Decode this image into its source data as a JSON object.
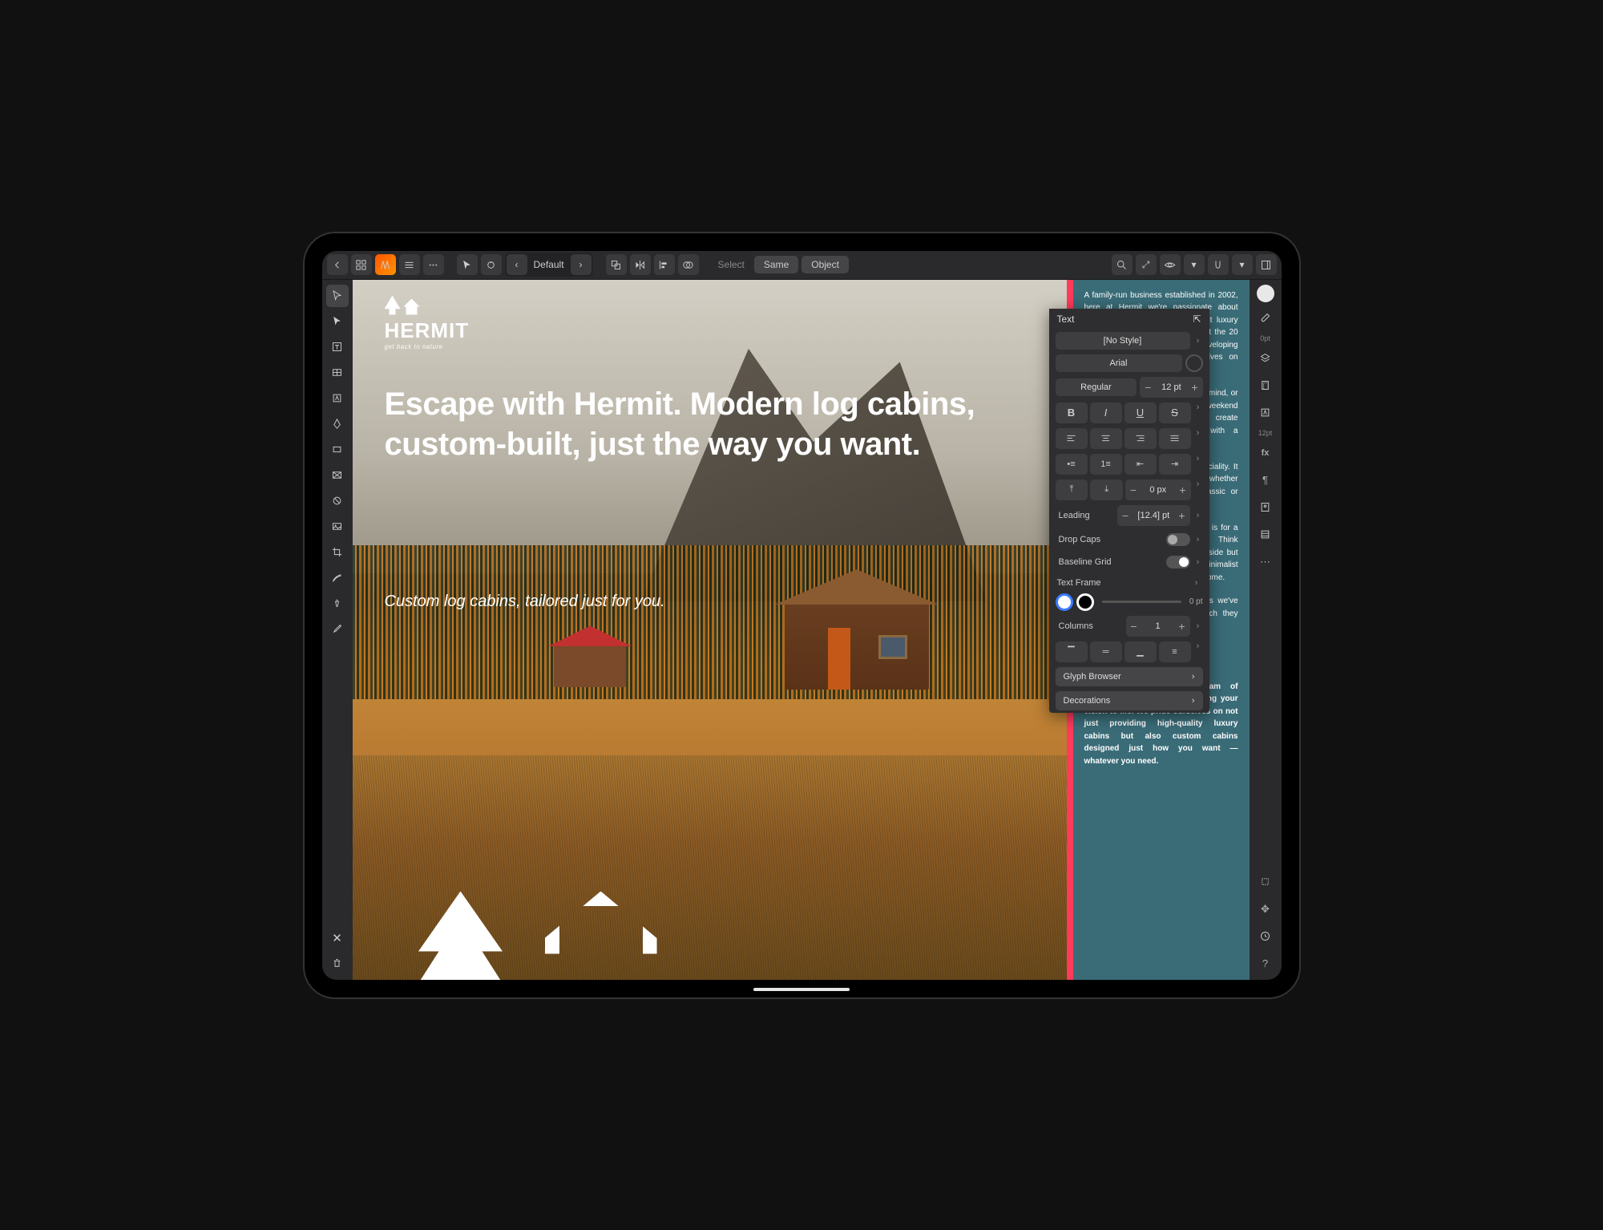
{
  "topbar": {
    "preset_label": "Default",
    "select_label": "Select",
    "same_label": "Same",
    "object_label": "Object"
  },
  "document": {
    "brand_name": "HERMIT",
    "brand_tagline": "get back to nature",
    "headline": "Escape with Hermit. Modern log cabins, custom-built, just the way you want.",
    "subhead": "Custom log cabins, tailored just for you.",
    "body": {
      "p1": "A family-run business established in 2002, here at Hermit we're passionate about bringing your vision of the perfect luxury log cabin to life. Based throughout the 20 years of designing, building and developing custom cabins, we pride ourselves on providing the absolute best.",
      "p2": "Maybe you've got a plot of land in mind, or you're looking for that perfect weekend home. Perhaps you want to create something unique, something with a contemporary Scandinavian feel.",
      "p3": "Traditional log cabins are our speciality. It is our most popular request — whether small or a larger build, with classic or modern architectural touches.",
      "p4": "One of our most popular requests is for a blend of rustic and modern. Think reclaimed black timber on the outside but with wide-plank floors and rather minimalist spacious interiors throughout the home.",
      "p5": "Many of our clients whose cabins we've built over the years feature which they love.",
      "p_bold": "Work with our talented team of architects and designers to bring your vision to life. We pride ourselves on not just providing high-quality luxury cabins but also custom cabins designed just how you want — whatever you need."
    }
  },
  "text_panel": {
    "title": "Text",
    "style": "[No Style]",
    "font_family": "Arial",
    "font_weight": "Regular",
    "font_size": "12 pt",
    "indent_value": "0 px",
    "leading_label": "Leading",
    "leading_value": "[12.4] pt",
    "drop_caps_label": "Drop Caps",
    "baseline_grid_label": "Baseline Grid",
    "text_frame_label": "Text Frame",
    "stroke_value": "0 pt",
    "columns_label": "Columns",
    "columns_value": "1",
    "glyph_browser": "Glyph Browser",
    "decorations": "Decorations"
  },
  "far_right": {
    "stroke_width": "0pt"
  }
}
